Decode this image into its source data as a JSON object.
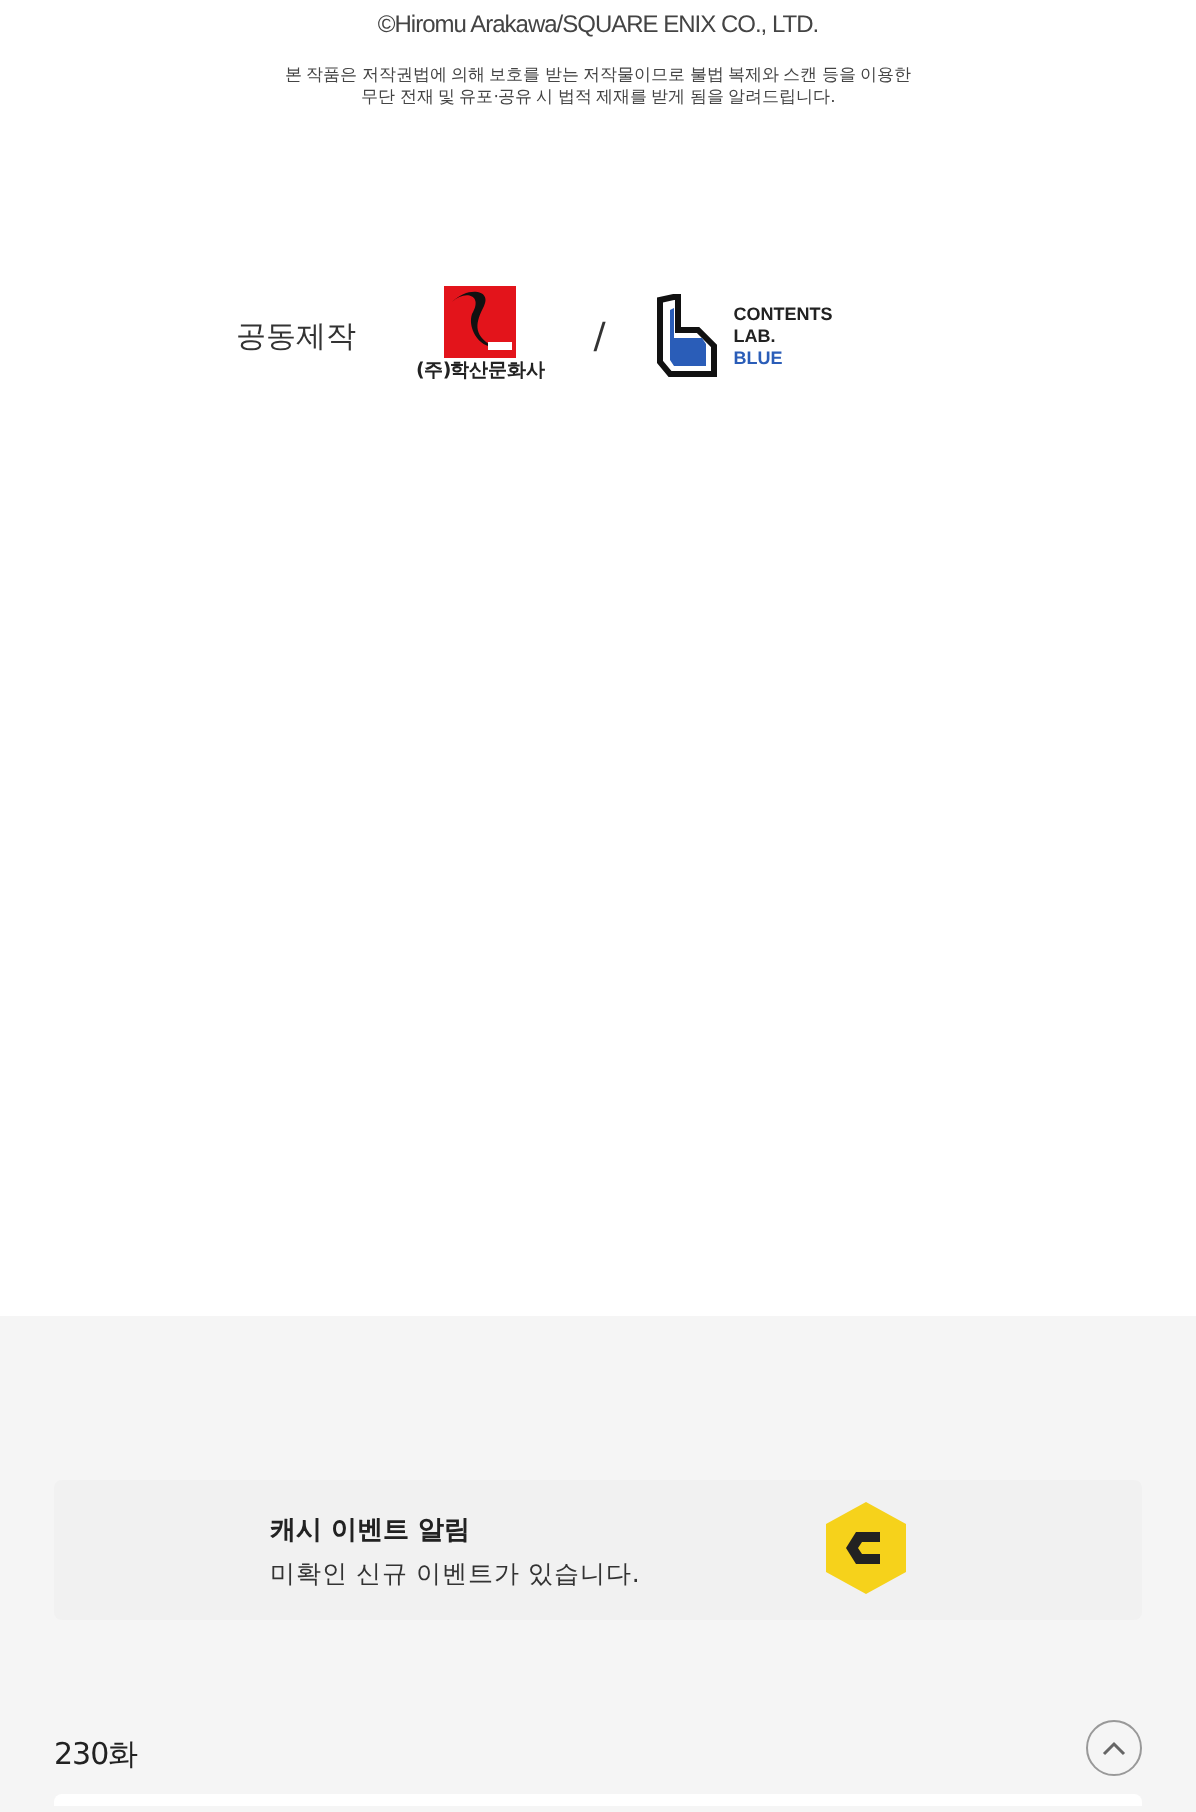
{
  "copyright": "©Hiromu Arakawa/SQUARE ENIX CO., LTD.",
  "notice_lines": [
    "본 작품은 저작권법에 의해 보호를 받는 저작물이므로 불법 복제와 스캔 등을 이용한",
    "무단 전재 및 유포·공유 시 법적 제재를 받게 됨을 알려드립니다."
  ],
  "coproduction": {
    "label": "공동제작",
    "publisher_name": "(주)학산문화사",
    "separator": "/",
    "studio_lines": [
      "CONTENTS",
      "LAB.",
      "BLUE"
    ]
  },
  "event_banner": {
    "title": "캐시 이벤트 알림",
    "message": "미확인 신규 이벤트가 있습니다."
  },
  "episode": {
    "title": "230화"
  }
}
